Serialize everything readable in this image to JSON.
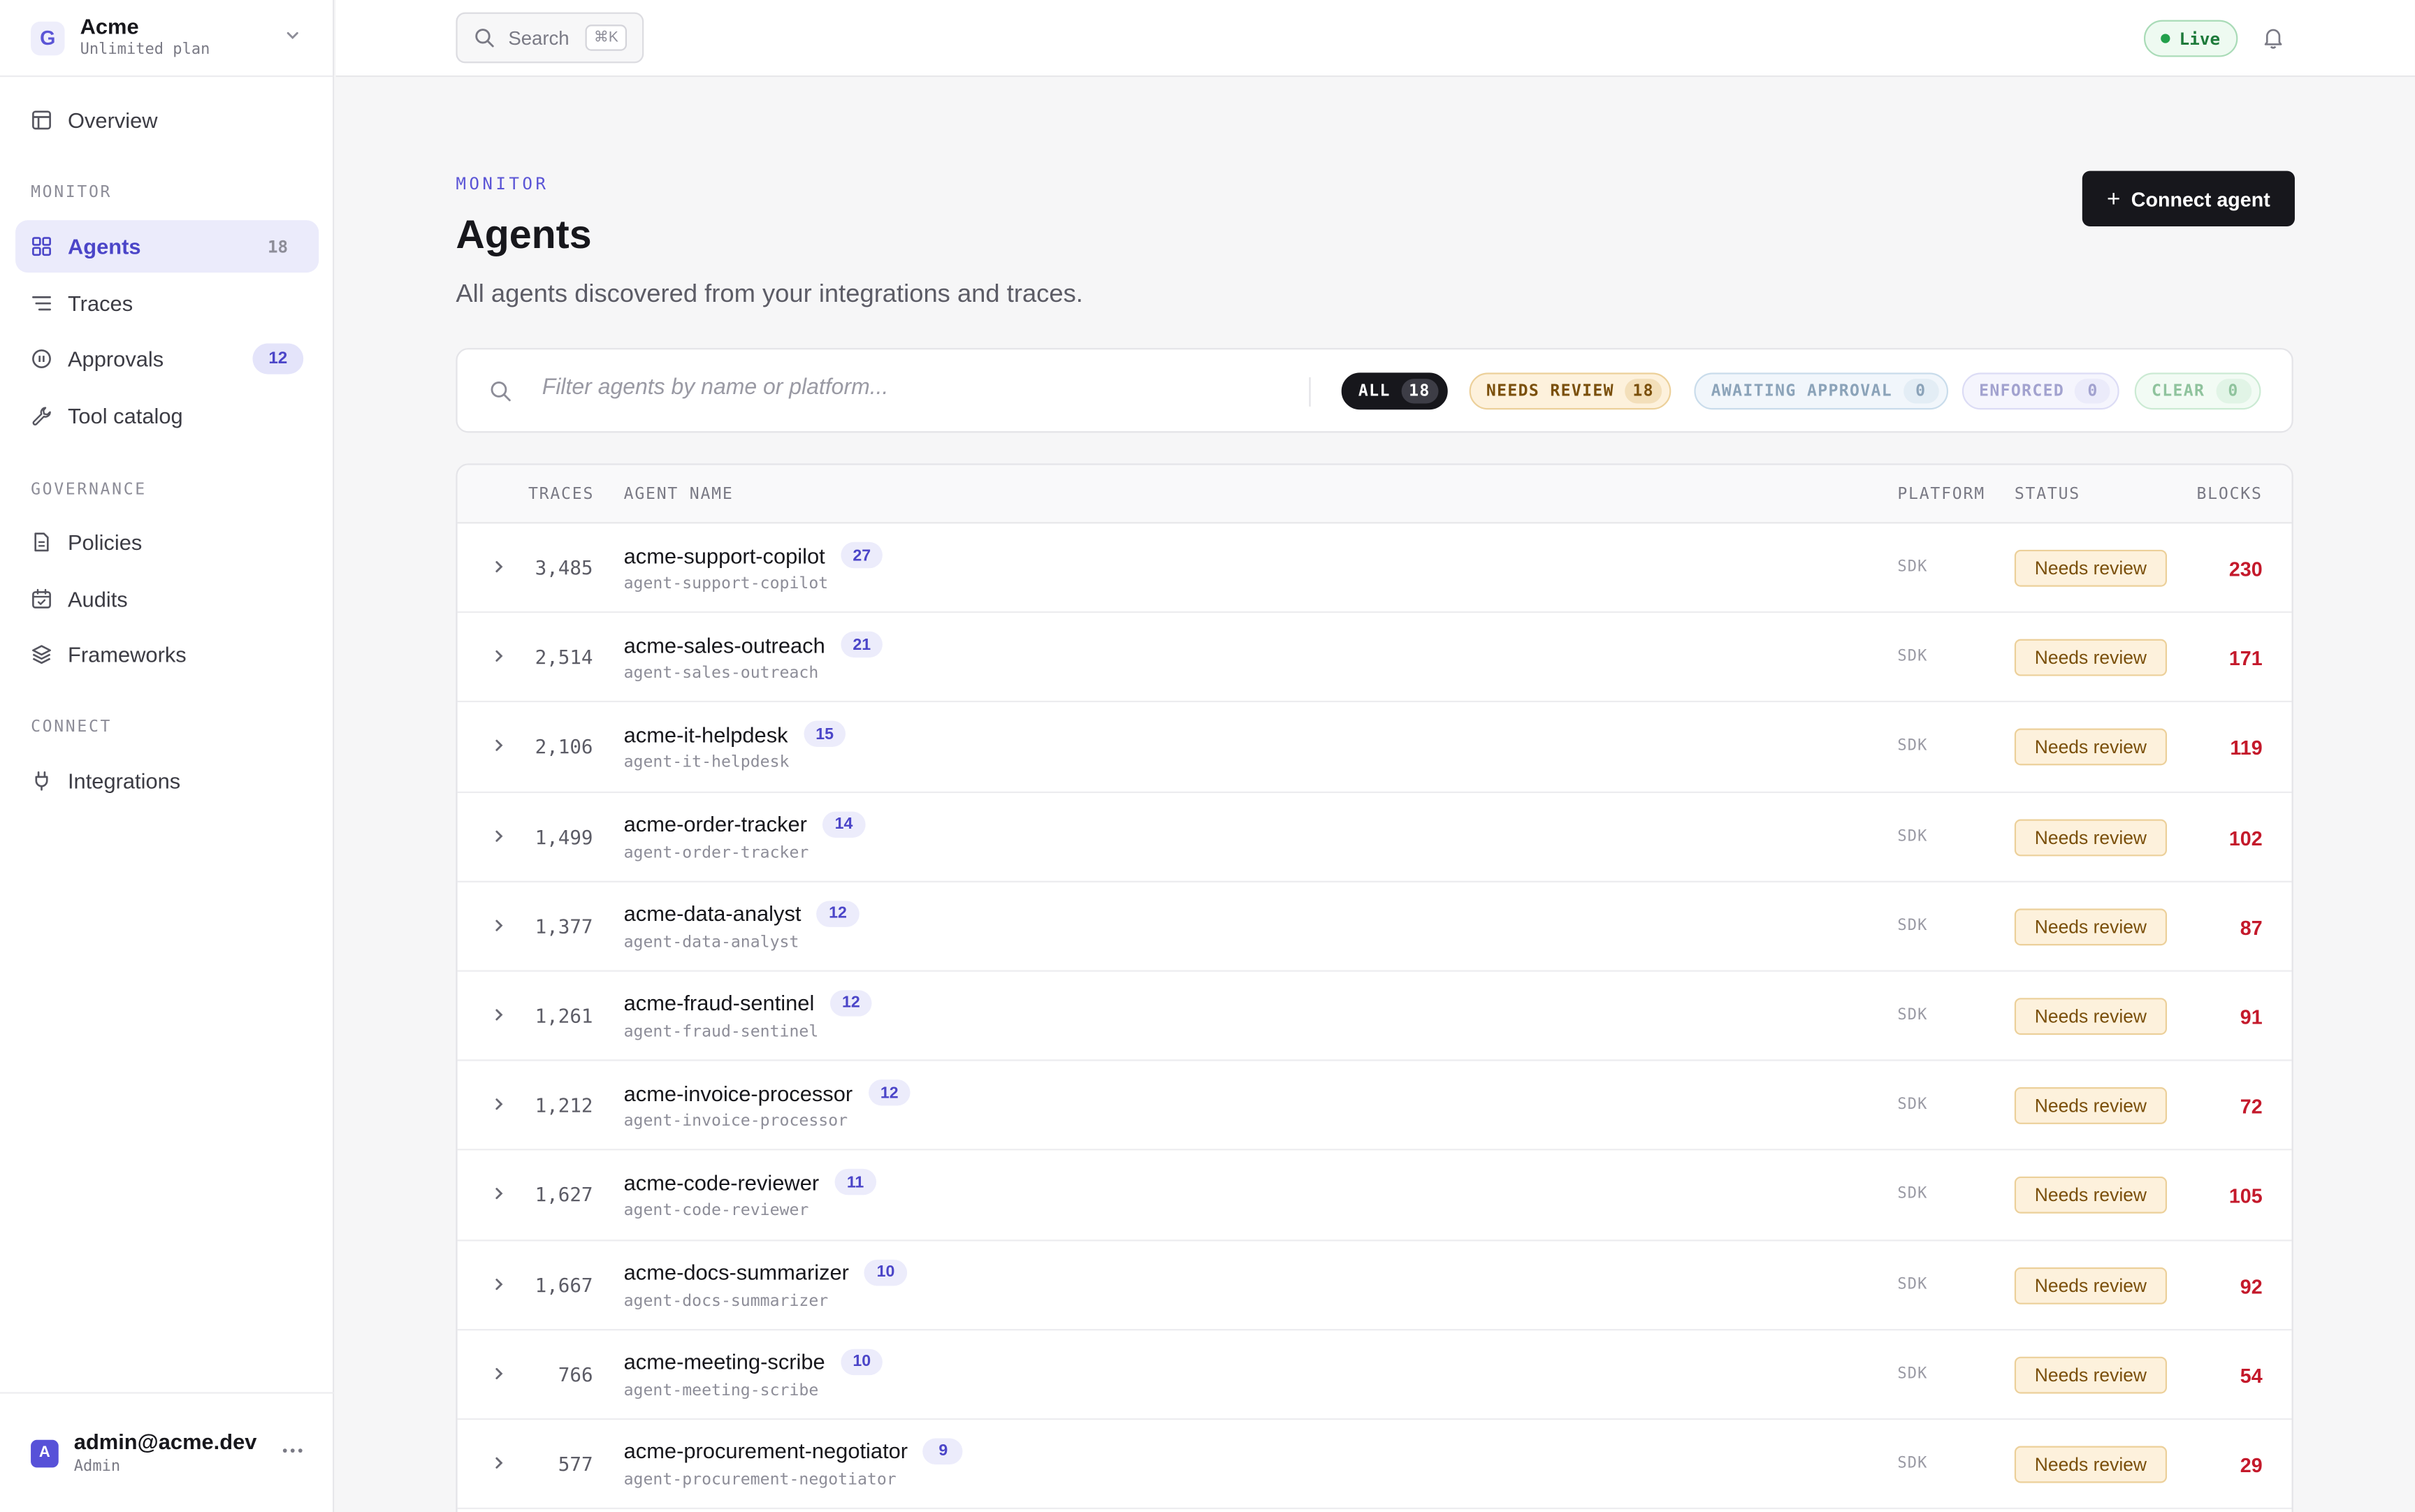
{
  "workspace": {
    "logo": "G",
    "name": "Acme",
    "plan": "Unlimited plan"
  },
  "nav": {
    "overview": "Overview",
    "monitor_section": "MONITOR",
    "agents": "Agents",
    "agents_count": "18",
    "traces": "Traces",
    "approvals": "Approvals",
    "approvals_count": "12",
    "tool_catalog": "Tool catalog",
    "governance_section": "GOVERNANCE",
    "policies": "Policies",
    "audits": "Audits",
    "frameworks": "Frameworks",
    "connect_section": "CONNECT",
    "integrations": "Integrations"
  },
  "user": {
    "initial": "A",
    "email": "admin@acme.dev",
    "role": "Admin"
  },
  "topbar": {
    "search_label": "Search",
    "search_shortcut": "⌘K",
    "live_label": "Live"
  },
  "header": {
    "eyebrow": "MONITOR",
    "title": "Agents",
    "subtitle": "All agents discovered from your integrations and traces.",
    "connect_button": "Connect agent"
  },
  "filters": {
    "placeholder": "Filter agents by name or platform...",
    "chips": [
      {
        "label": "ALL",
        "count": "18"
      },
      {
        "label": "NEEDS REVIEW",
        "count": "18"
      },
      {
        "label": "AWAITING APPROVAL",
        "count": "0"
      },
      {
        "label": "ENFORCED",
        "count": "0"
      },
      {
        "label": "CLEAR",
        "count": "0"
      }
    ]
  },
  "table": {
    "columns": {
      "traces": "TRACES",
      "agent_name": "AGENT NAME",
      "platform": "PLATFORM",
      "status": "STATUS",
      "blocks": "BLOCKS"
    },
    "rows": [
      {
        "traces": "3,485",
        "name": "acme-support-copilot",
        "count": "27",
        "slug": "agent-support-copilot",
        "platform": "SDK",
        "status": "Needs review",
        "blocks": "230"
      },
      {
        "traces": "2,514",
        "name": "acme-sales-outreach",
        "count": "21",
        "slug": "agent-sales-outreach",
        "platform": "SDK",
        "status": "Needs review",
        "blocks": "171"
      },
      {
        "traces": "2,106",
        "name": "acme-it-helpdesk",
        "count": "15",
        "slug": "agent-it-helpdesk",
        "platform": "SDK",
        "status": "Needs review",
        "blocks": "119"
      },
      {
        "traces": "1,499",
        "name": "acme-order-tracker",
        "count": "14",
        "slug": "agent-order-tracker",
        "platform": "SDK",
        "status": "Needs review",
        "blocks": "102"
      },
      {
        "traces": "1,377",
        "name": "acme-data-analyst",
        "count": "12",
        "slug": "agent-data-analyst",
        "platform": "SDK",
        "status": "Needs review",
        "blocks": "87"
      },
      {
        "traces": "1,261",
        "name": "acme-fraud-sentinel",
        "count": "12",
        "slug": "agent-fraud-sentinel",
        "platform": "SDK",
        "status": "Needs review",
        "blocks": "91"
      },
      {
        "traces": "1,212",
        "name": "acme-invoice-processor",
        "count": "12",
        "slug": "agent-invoice-processor",
        "platform": "SDK",
        "status": "Needs review",
        "blocks": "72"
      },
      {
        "traces": "1,627",
        "name": "acme-code-reviewer",
        "count": "11",
        "slug": "agent-code-reviewer",
        "platform": "SDK",
        "status": "Needs review",
        "blocks": "105"
      },
      {
        "traces": "1,667",
        "name": "acme-docs-summarizer",
        "count": "10",
        "slug": "agent-docs-summarizer",
        "platform": "SDK",
        "status": "Needs review",
        "blocks": "92"
      },
      {
        "traces": "766",
        "name": "acme-meeting-scribe",
        "count": "10",
        "slug": "agent-meeting-scribe",
        "platform": "SDK",
        "status": "Needs review",
        "blocks": "54"
      },
      {
        "traces": "577",
        "name": "acme-procurement-negotiator",
        "count": "9",
        "slug": "agent-procurement-negotiator",
        "platform": "SDK",
        "status": "Needs review",
        "blocks": "29"
      }
    ]
  }
}
